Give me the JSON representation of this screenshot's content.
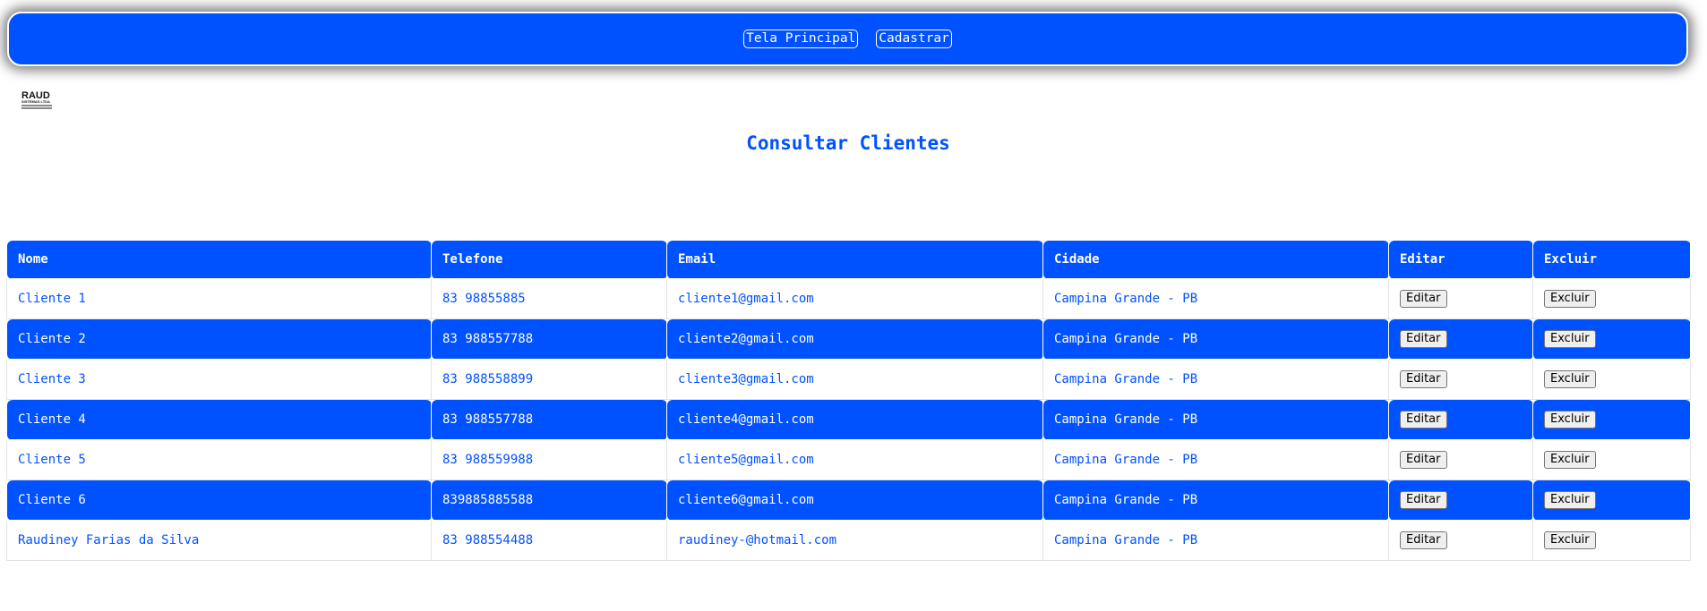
{
  "nav": {
    "buttons": [
      "Tela Principal",
      "Cadastrar"
    ]
  },
  "logo": {
    "text": "RAUD",
    "subtext": "SISTEMAS LTDA"
  },
  "page": {
    "title": "Consultar Clientes"
  },
  "table": {
    "headers": [
      "Nome",
      "Telefone",
      "Email",
      "Cidade",
      "Editar",
      "Excluir"
    ],
    "edit_label": "Editar",
    "delete_label": "Excluir",
    "rows": [
      {
        "nome": "Cliente 1",
        "telefone": "83 98855885",
        "email": "cliente1@gmail.com",
        "cidade": "Campina Grande - PB"
      },
      {
        "nome": "Cliente 2",
        "telefone": "83 988557788",
        "email": "cliente2@gmail.com",
        "cidade": "Campina Grande - PB"
      },
      {
        "nome": "Cliente 3",
        "telefone": "83 988558899",
        "email": "cliente3@gmail.com",
        "cidade": "Campina Grande - PB"
      },
      {
        "nome": "Cliente 4",
        "telefone": "83 988557788",
        "email": "cliente4@gmail.com",
        "cidade": "Campina Grande - PB"
      },
      {
        "nome": "Cliente 5",
        "telefone": "83 988559988",
        "email": "cliente5@gmail.com",
        "cidade": "Campina Grande - PB"
      },
      {
        "nome": "Cliente 6",
        "telefone": "839885885588",
        "email": "cliente6@gmail.com",
        "cidade": "Campina Grande - PB"
      },
      {
        "nome": "Raudiney Farias da Silva",
        "telefone": "83 988554488",
        "email": "raudiney-@hotmail.com",
        "cidade": "Campina Grande - PB"
      }
    ]
  },
  "colors": {
    "accent": "#0051ff",
    "background": "#ffffff"
  }
}
